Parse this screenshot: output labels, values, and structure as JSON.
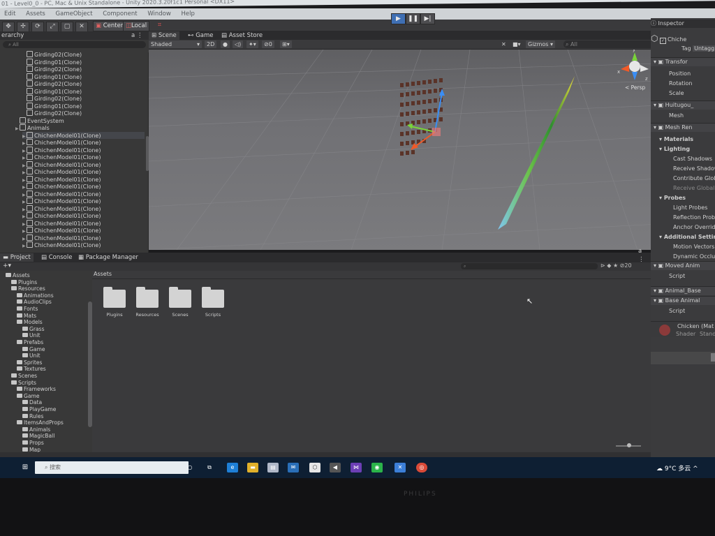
{
  "window": {
    "title": "01 - Level0_0 - PC, Mac & Unix Standalone - Unity 2020.3.20f1c1 Personal <DX11>",
    "menu": [
      "Edit",
      "Assets",
      "GameObject",
      "Component",
      "Window",
      "Help"
    ]
  },
  "toolbar": {
    "pivot_center": "Center",
    "pivot_local": "Local"
  },
  "hierarchy": {
    "title": "erarchy",
    "search_placeholder": "All",
    "rows": [
      {
        "label": "Girding02(Clone)",
        "indent": 3,
        "arrow": false
      },
      {
        "label": "Girding01(Clone)",
        "indent": 3,
        "arrow": false
      },
      {
        "label": "Girding02(Clone)",
        "indent": 3,
        "arrow": false
      },
      {
        "label": "Girding01(Clone)",
        "indent": 3,
        "arrow": false
      },
      {
        "label": "Girding02(Clone)",
        "indent": 3,
        "arrow": false
      },
      {
        "label": "Girding01(Clone)",
        "indent": 3,
        "arrow": false
      },
      {
        "label": "Girding02(Clone)",
        "indent": 3,
        "arrow": false
      },
      {
        "label": "Girding01(Clone)",
        "indent": 3,
        "arrow": false
      },
      {
        "label": "Girding02(Clone)",
        "indent": 3,
        "arrow": false
      },
      {
        "label": "EventSystem",
        "indent": 2,
        "arrow": false
      },
      {
        "label": "Animals",
        "indent": 2,
        "arrow": true
      },
      {
        "label": "ChichenModel01(Clone)",
        "indent": 3,
        "arrow": true
      },
      {
        "label": "ChichenModel01(Clone)",
        "indent": 3,
        "arrow": true
      },
      {
        "label": "ChichenModel01(Clone)",
        "indent": 3,
        "arrow": true
      },
      {
        "label": "ChichenModel01(Clone)",
        "indent": 3,
        "arrow": true
      },
      {
        "label": "ChichenModel01(Clone)",
        "indent": 3,
        "arrow": true
      },
      {
        "label": "ChichenModel01(Clone)",
        "indent": 3,
        "arrow": true
      },
      {
        "label": "ChichenModel01(Clone)",
        "indent": 3,
        "arrow": true
      },
      {
        "label": "ChichenModel01(Clone)",
        "indent": 3,
        "arrow": true
      },
      {
        "label": "ChichenModel01(Clone)",
        "indent": 3,
        "arrow": true
      },
      {
        "label": "ChichenModel01(Clone)",
        "indent": 3,
        "arrow": true
      },
      {
        "label": "ChichenModel01(Clone)",
        "indent": 3,
        "arrow": true
      },
      {
        "label": "ChichenModel01(Clone)",
        "indent": 3,
        "arrow": true
      },
      {
        "label": "ChichenModel01(Clone)",
        "indent": 3,
        "arrow": true
      },
      {
        "label": "ChichenModel01(Clone)",
        "indent": 3,
        "arrow": true
      },
      {
        "label": "ChichenModel01(Clone)",
        "indent": 3,
        "arrow": true
      },
      {
        "label": "ChichenModel01(Clone)",
        "indent": 3,
        "arrow": true
      }
    ]
  },
  "scene": {
    "tabs": [
      "Scene",
      "Game",
      "Asset Store"
    ],
    "shading": "Shaded",
    "mode_2d": "2D",
    "gizmos": "Gizmos",
    "search_placeholder": "All",
    "persp_label": "< Persp",
    "hidden_count": "0"
  },
  "inspector": {
    "title": "Inspector",
    "object_name": "Chiche",
    "tag_label": "Tag",
    "tag_value": "Untagg",
    "rows": [
      {
        "label": "Transfor",
        "type": "header"
      },
      {
        "label": "Position",
        "type": "field"
      },
      {
        "label": "Rotation",
        "type": "field"
      },
      {
        "label": "Scale",
        "type": "field"
      },
      {
        "label": "Huitugou_",
        "type": "header"
      },
      {
        "label": "Mesh",
        "type": "field"
      },
      {
        "label": "Mesh Ren",
        "type": "header"
      },
      {
        "label": "Materials",
        "type": "section"
      },
      {
        "label": "Lighting",
        "type": "section"
      },
      {
        "label": "Cast Shadows",
        "type": "subfield"
      },
      {
        "label": "Receive Shadow",
        "type": "subfield"
      },
      {
        "label": "Contribute Glob",
        "type": "subfield"
      },
      {
        "label": "Receive Global",
        "type": "subfield"
      },
      {
        "label": "Probes",
        "type": "section"
      },
      {
        "label": "Light Probes",
        "type": "subfield"
      },
      {
        "label": "Reflection Probe",
        "type": "subfield"
      },
      {
        "label": "Anchor Override",
        "type": "subfield"
      },
      {
        "label": "Additional Setting",
        "type": "section"
      },
      {
        "label": "Motion Vectors",
        "type": "subfield"
      },
      {
        "label": "Dynamic Occlus",
        "type": "subfield"
      },
      {
        "label": "Moved Anim",
        "type": "header"
      },
      {
        "label": "Script",
        "type": "field"
      },
      {
        "label": "Animal_Base",
        "type": "header"
      },
      {
        "label": "Base Animal",
        "type": "header"
      },
      {
        "label": "Script",
        "type": "field"
      }
    ],
    "material_name": "Chicken (Mat",
    "shader_label": "Shader",
    "shader_value": "Stand"
  },
  "project": {
    "tabs": [
      "Project",
      "Console",
      "Package Manager"
    ],
    "tree": [
      {
        "label": "Assets",
        "indent": 1
      },
      {
        "label": "Plugins",
        "indent": 2
      },
      {
        "label": "Resources",
        "indent": 2
      },
      {
        "label": "Animations",
        "indent": 3
      },
      {
        "label": "AudioClips",
        "indent": 3
      },
      {
        "label": "Fonts",
        "indent": 3
      },
      {
        "label": "Mats",
        "indent": 3
      },
      {
        "label": "Models",
        "indent": 3
      },
      {
        "label": "Grass",
        "indent": 4
      },
      {
        "label": "Unit",
        "indent": 4
      },
      {
        "label": "Prefabs",
        "indent": 3
      },
      {
        "label": "Game",
        "indent": 4
      },
      {
        "label": "Unit",
        "indent": 4
      },
      {
        "label": "Sprites",
        "indent": 3
      },
      {
        "label": "Textures",
        "indent": 3
      },
      {
        "label": "Scenes",
        "indent": 2
      },
      {
        "label": "Scripts",
        "indent": 2
      },
      {
        "label": "Frameworks",
        "indent": 3
      },
      {
        "label": "Game",
        "indent": 3
      },
      {
        "label": "Data",
        "indent": 4
      },
      {
        "label": "PlayGame",
        "indent": 4
      },
      {
        "label": "Rules",
        "indent": 4
      },
      {
        "label": "ItemsAndProps",
        "indent": 3
      },
      {
        "label": "Animals",
        "indent": 4
      },
      {
        "label": "MagicBall",
        "indent": 4
      },
      {
        "label": "Props",
        "indent": 4
      },
      {
        "label": "Map",
        "indent": 4
      }
    ],
    "breadcrumb": "Assets",
    "folders": [
      "Plugins",
      "Resources",
      "Scenes",
      "Scripts"
    ],
    "hidden_count": "20"
  },
  "taskbar": {
    "search_placeholder": "搜索",
    "weather": "9°C 多云"
  },
  "monitor_brand": "PHILIPS"
}
